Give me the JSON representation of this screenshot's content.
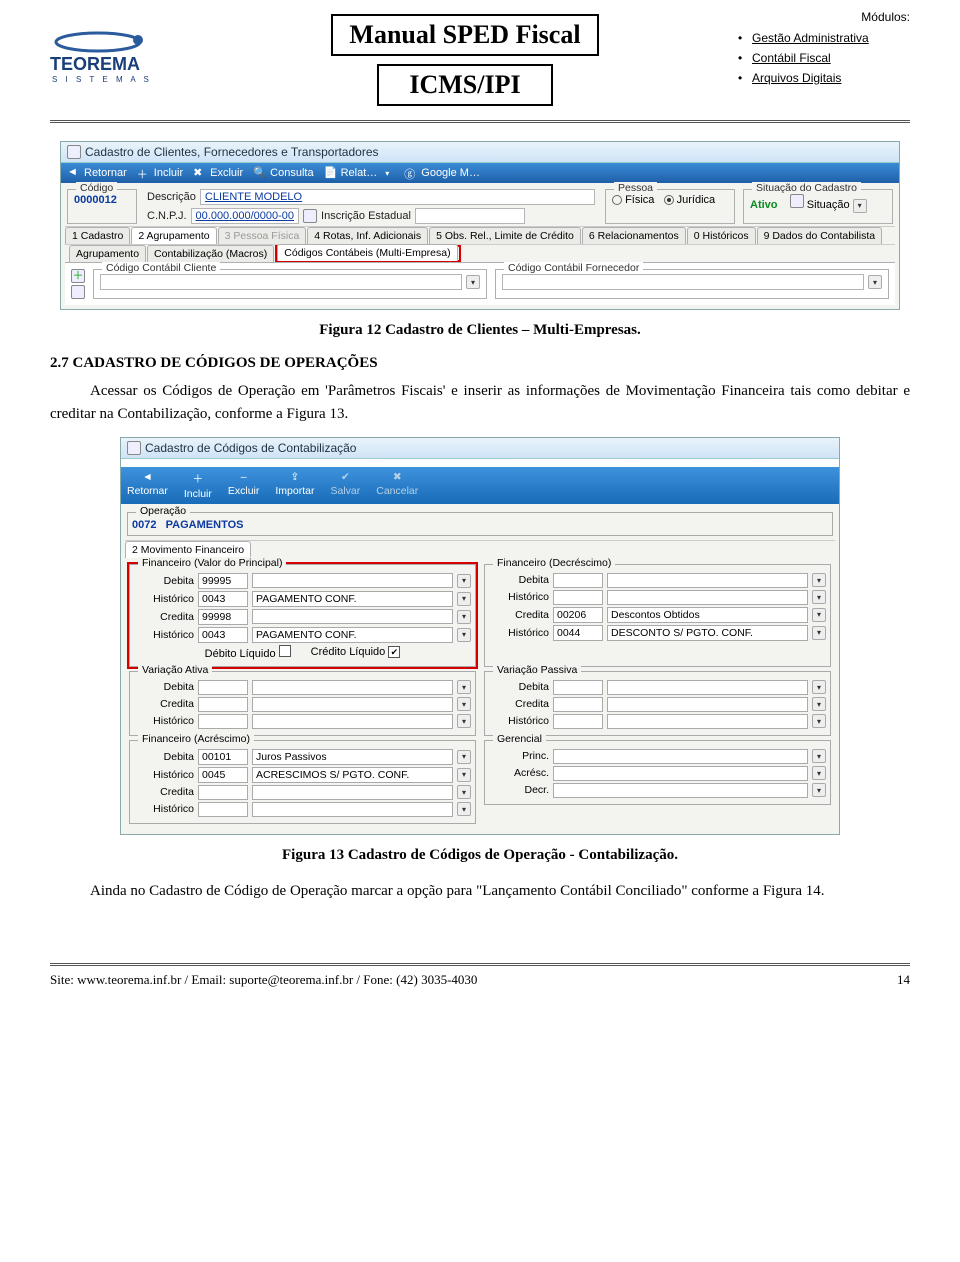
{
  "header": {
    "logo_top": "TEOREMA",
    "logo_bottom": "S I S T E M A S",
    "title1": "Manual SPED Fiscal",
    "title2": "ICMS/IPI",
    "modules_label": "Módulos:",
    "modules": [
      "Gestão Administrativa",
      "Contábil Fiscal",
      "Arquivos Digitais"
    ]
  },
  "fig12": {
    "window_title": "Cadastro de Clientes, Fornecedores e Transportadores",
    "toolbar": {
      "retornar": "Retornar",
      "incluir": "Incluir",
      "excluir": "Excluir",
      "consulta": "Consulta",
      "relat": "Relat…",
      "google": "Google M…"
    },
    "fields": {
      "codigo_label": "Código",
      "codigo": "0000012",
      "descricao_label": "Descrição",
      "descricao": "CLIENTE MODELO",
      "cnpj_label": "C.N.P.J.",
      "cnpj": "00.000.000/0000-00",
      "ie_label": "Inscrição Estadual",
      "pessoa_legend": "Pessoa",
      "fisica": "Física",
      "juridica": "Jurídica",
      "situacao_legend": "Situação do Cadastro",
      "situacao_val": "Ativo",
      "situacao_btn": "Situação"
    },
    "tabs_top": [
      "1 Cadastro",
      "2 Agrupamento",
      "3 Pessoa Física",
      "4 Rotas, Inf. Adicionais",
      "5 Obs. Rel., Limite de Crédito",
      "6 Relacionamentos",
      "0 Históricos",
      "9 Dados do Contabilista"
    ],
    "tabs_sub": [
      "Agrupamento",
      "Contabilização (Macros)",
      "Códigos Contábeis (Multi-Empresa)"
    ],
    "grp_cli": "Código Contábil Cliente",
    "grp_for": "Código Contábil Fornecedor",
    "caption": "Figura 12 Cadastro de Clientes – Multi-Empresas."
  },
  "section": {
    "heading": "2.7 CADASTRO DE CÓDIGOS DE OPERAÇÕES",
    "p1a": "Acessar os Códigos de Operação em 'Parâmetros Fiscais' e inserir as informações de Movimentação Financeira tais como debitar e creditar na Contabilização, conforme a Figura 13."
  },
  "fig13": {
    "window_title": "Cadastro de Códigos de Contabilização",
    "tool": {
      "retornar": "Retornar",
      "incluir": "Incluir",
      "excluir": "Excluir",
      "importar": "Importar",
      "salvar": "Salvar",
      "cancelar": "Cancelar"
    },
    "operacao_legend": "Operação",
    "op_code": "0072",
    "op_name": "PAGAMENTOS",
    "tab": "2 Movimento Financeiro",
    "grp_fp": "Financeiro (Valor do Principal)",
    "grp_fd": "Financeiro (Decréscimo)",
    "grp_va": "Variação Ativa",
    "grp_vp": "Variação Passiva",
    "grp_fa": "Financeiro (Acréscimo)",
    "grp_ge": "Gerencial",
    "lbls": {
      "debita": "Debita",
      "credita": "Credita",
      "historico": "Histórico",
      "princ": "Princ.",
      "acresc": "Acrésc.",
      "decr": "Decr.",
      "debliq": "Débito Líquido",
      "credliq": "Crédito Líquido"
    },
    "vals": {
      "fp_deb": "99995",
      "fp_hist1": "0043",
      "fp_hist1_txt": "PAGAMENTO CONF.",
      "fp_cred": "99998",
      "fp_hist2": "0043",
      "fp_hist2_txt": "PAGAMENTO CONF.",
      "fd_cred": "00206",
      "fd_cred_txt": "Descontos Obtidos",
      "fd_hist": "0044",
      "fd_hist_txt": "DESCONTO S/ PGTO. CONF.",
      "fa_deb": "00101",
      "fa_deb_txt": "Juros Passivos",
      "fa_hist": "0045",
      "fa_hist_txt": "ACRESCIMOS S/ PGTO. CONF."
    },
    "caption": "Figura 13 Cadastro de Códigos de Operação - Contabilização."
  },
  "after": {
    "p": "Ainda no Cadastro de Código de Operação marcar a opção para \"Lançamento Contábil Conciliado\" conforme a Figura 14."
  },
  "footer": {
    "left": "Site: www.teorema.inf.br / Email: suporte@teorema.inf.br / Fone: (42) 3035-4030",
    "right": "14"
  }
}
